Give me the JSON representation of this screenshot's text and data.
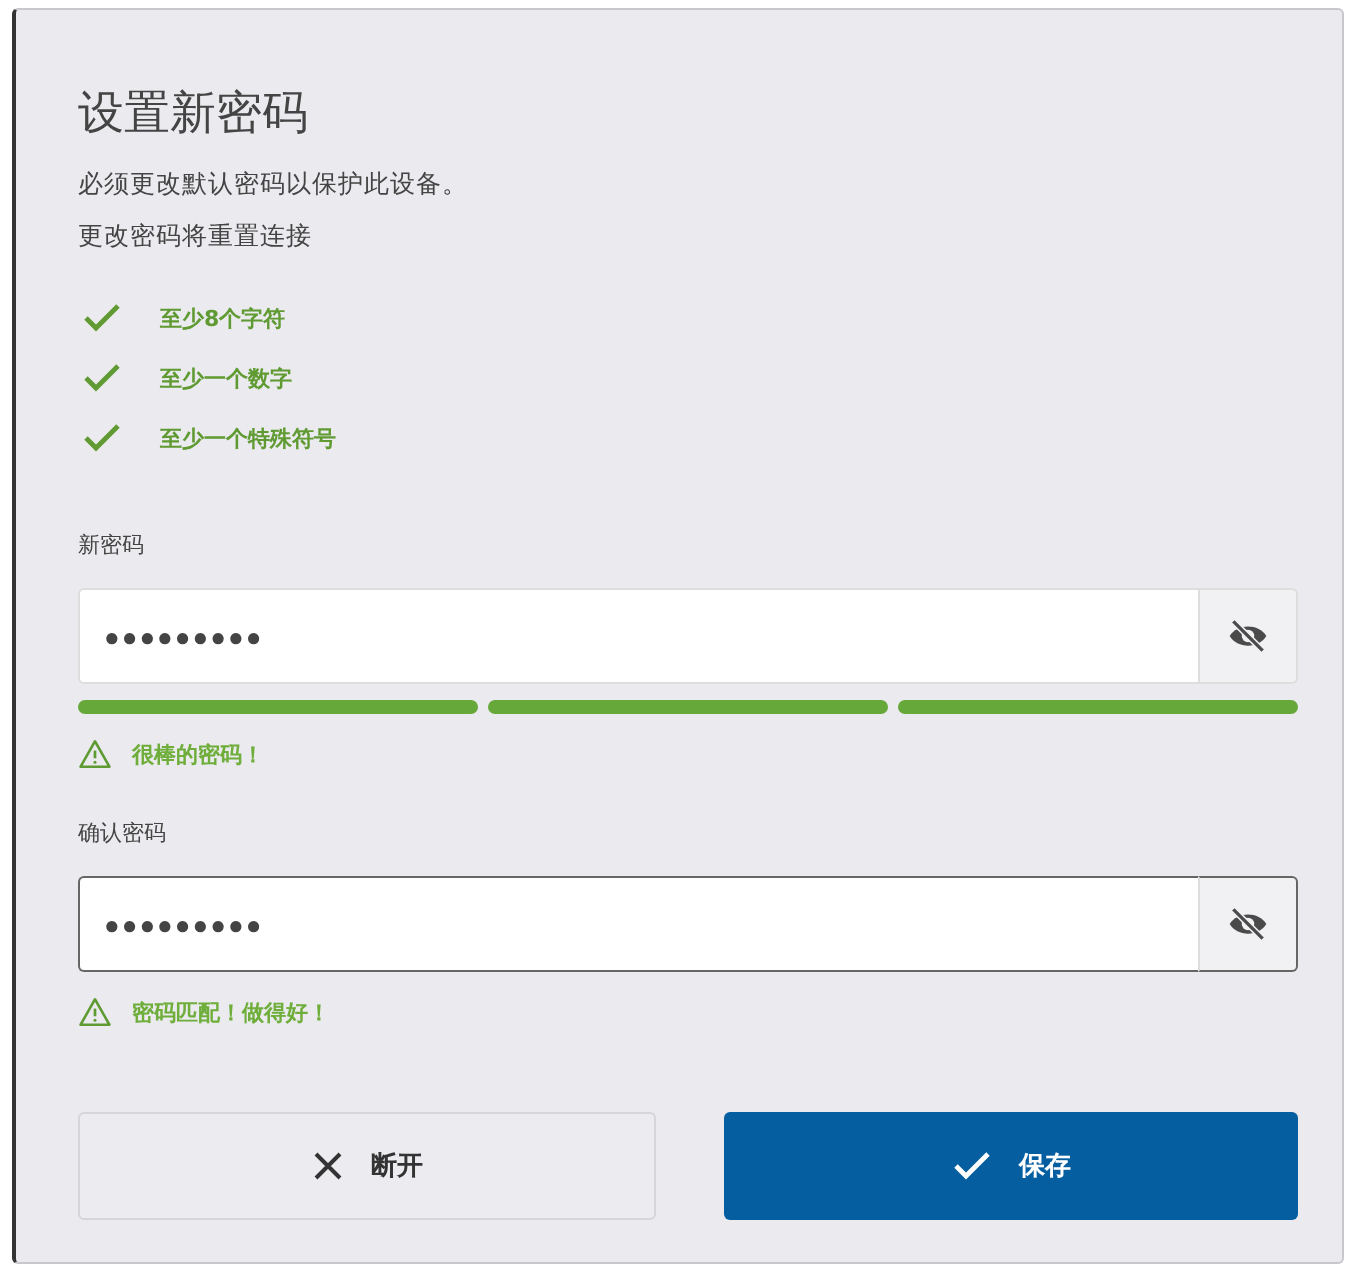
{
  "dialog": {
    "title": "设置新密码",
    "lines": [
      "必须更改默认密码以保护此设备。",
      "更改密码将重置连接"
    ]
  },
  "requirements": [
    {
      "text": "至少8个字符",
      "met": true
    },
    {
      "text": "至少一个数字",
      "met": true
    },
    {
      "text": "至少一个特殊符号",
      "met": true
    }
  ],
  "new_password": {
    "label": "新密码",
    "value": "●●●●●●●●●",
    "focused": false,
    "strength": [
      {
        "filled": true
      },
      {
        "filled": true
      },
      {
        "filled": true
      }
    ],
    "message": "很棒的密码！"
  },
  "confirm_password": {
    "label": "确认密码",
    "value": "●●●●●●●●●",
    "focused": true,
    "message": "密码匹配！做得好！"
  },
  "buttons": [
    {
      "kind": "cancel",
      "label": "断开"
    },
    {
      "kind": "save",
      "label": "保存"
    }
  ]
}
